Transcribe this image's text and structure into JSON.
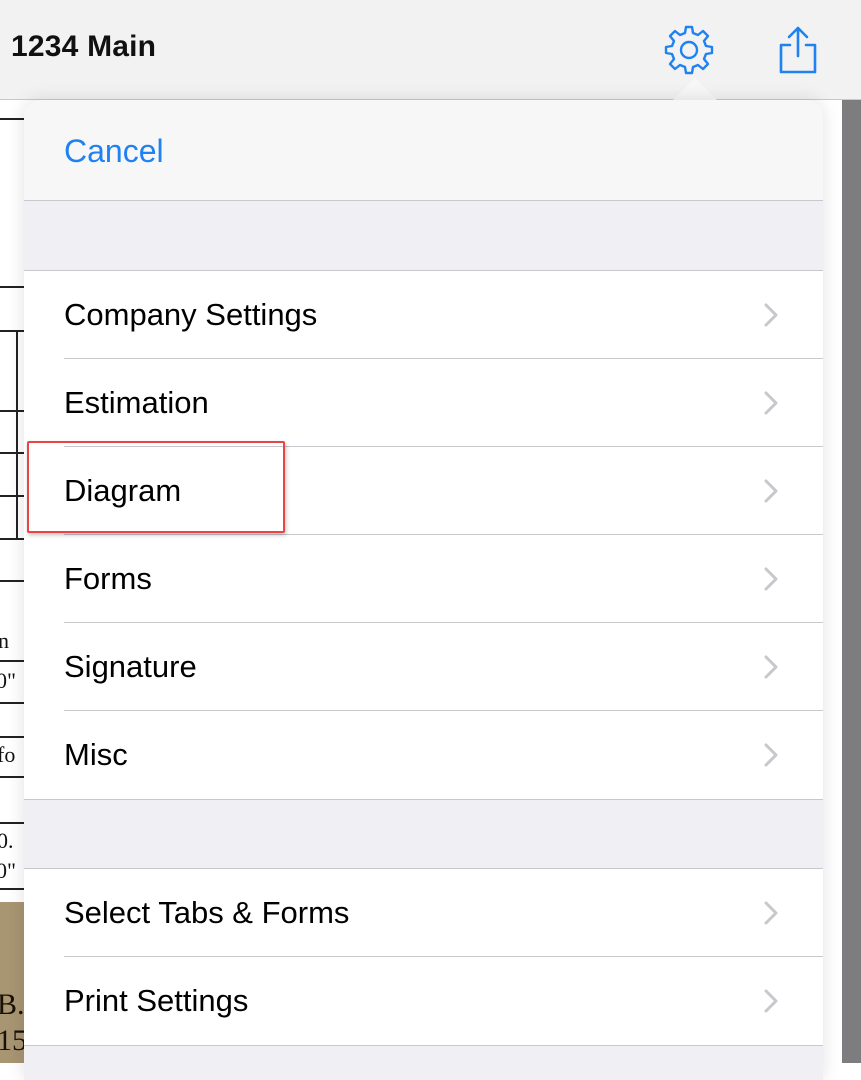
{
  "navbar": {
    "title": "1234 Main",
    "settings_icon": "gear-icon",
    "share_icon": "share-icon",
    "accent_color": "#1f82f0"
  },
  "background_doc": {
    "text_fragments": [
      "n",
      "0\"",
      "fo",
      "0.",
      "0\"",
      "B.",
      "15"
    ]
  },
  "popover": {
    "cancel_label": "Cancel",
    "groups": [
      {
        "items": [
          {
            "label": "Company Settings"
          },
          {
            "label": "Estimation"
          },
          {
            "label": "Diagram",
            "highlighted": true
          },
          {
            "label": "Forms"
          },
          {
            "label": "Signature"
          },
          {
            "label": "Misc"
          }
        ]
      },
      {
        "items": [
          {
            "label": "Select Tabs & Forms"
          },
          {
            "label": "Print Settings"
          }
        ]
      }
    ],
    "chevron_icon": "chevron-right-icon",
    "highlight_color": "#e84545"
  }
}
